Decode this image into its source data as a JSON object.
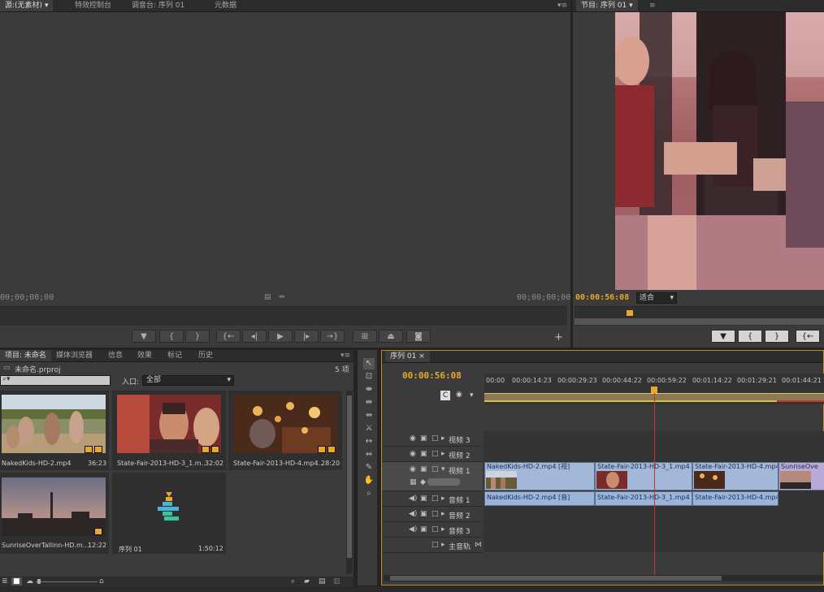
{
  "source_monitor": {
    "tabs": [
      "源:(无素材)",
      "特效控制台",
      "调音台: 序列 01",
      "元数据"
    ],
    "tab_dropdown": "▾",
    "timecode_left": "00;00;00;00",
    "timecode_right": "00;00;00;00",
    "menu": "▾≡"
  },
  "program_monitor": {
    "tab": "节目: 序列 01",
    "menu": "≡",
    "timecode": "00:00:56:08",
    "zoom": "适合"
  },
  "project": {
    "tabs": [
      "项目: 未命名",
      "媒体浏览器",
      "信息",
      "效果",
      "标记",
      "历史"
    ],
    "file_name": "未命名.prproj",
    "item_count": "5 项",
    "search_placeholder": "",
    "entry_label": "入口:",
    "entry_value": "全部",
    "items": [
      {
        "name": "NakedKids-HD-2.mp4",
        "duration": "36:23"
      },
      {
        "name": "State-Fair-2013-HD-3_1.m...",
        "duration": "32:02"
      },
      {
        "name": "State-Fair-2013-HD-4.mp4...",
        "duration": "28:20"
      },
      {
        "name": "SunriseOverTallinn-HD.m...",
        "duration": "12:22"
      },
      {
        "name": "序列 01",
        "duration": "1:50:12"
      }
    ]
  },
  "timeline": {
    "tab": "序列 01",
    "timecode": "00:00:56:08",
    "ruler": [
      "00:00",
      "00:00:14:23",
      "00:00:29:23",
      "00:00:44:22",
      "00:00:59:22",
      "00:01:14:22",
      "00:01:29:21",
      "00:01:44:21"
    ],
    "tracks": {
      "v3": "视频 3",
      "v2": "视频 2",
      "v1": "视频 1",
      "a1": "音频 1",
      "a2": "音频 2",
      "a3": "音频 3",
      "master": "主音轨"
    },
    "video_clips": [
      "NakedKids-HD-2.mp4 [视]",
      "State-Fair-2013-HD-3_1.mp4",
      "State-Fair-2013-HD-4.mp4",
      "SunriseOve"
    ],
    "audio_clips": [
      "NakedKids-HD-2.mp4 [音]",
      "State-Fair-2013-HD-3_1.mp4",
      "State-Fair-2013-HD-4.mp4"
    ]
  },
  "colors": {
    "accent": "#e8a92a",
    "playhead": "#c8322a",
    "clip_blue": "#a3b8d8"
  }
}
